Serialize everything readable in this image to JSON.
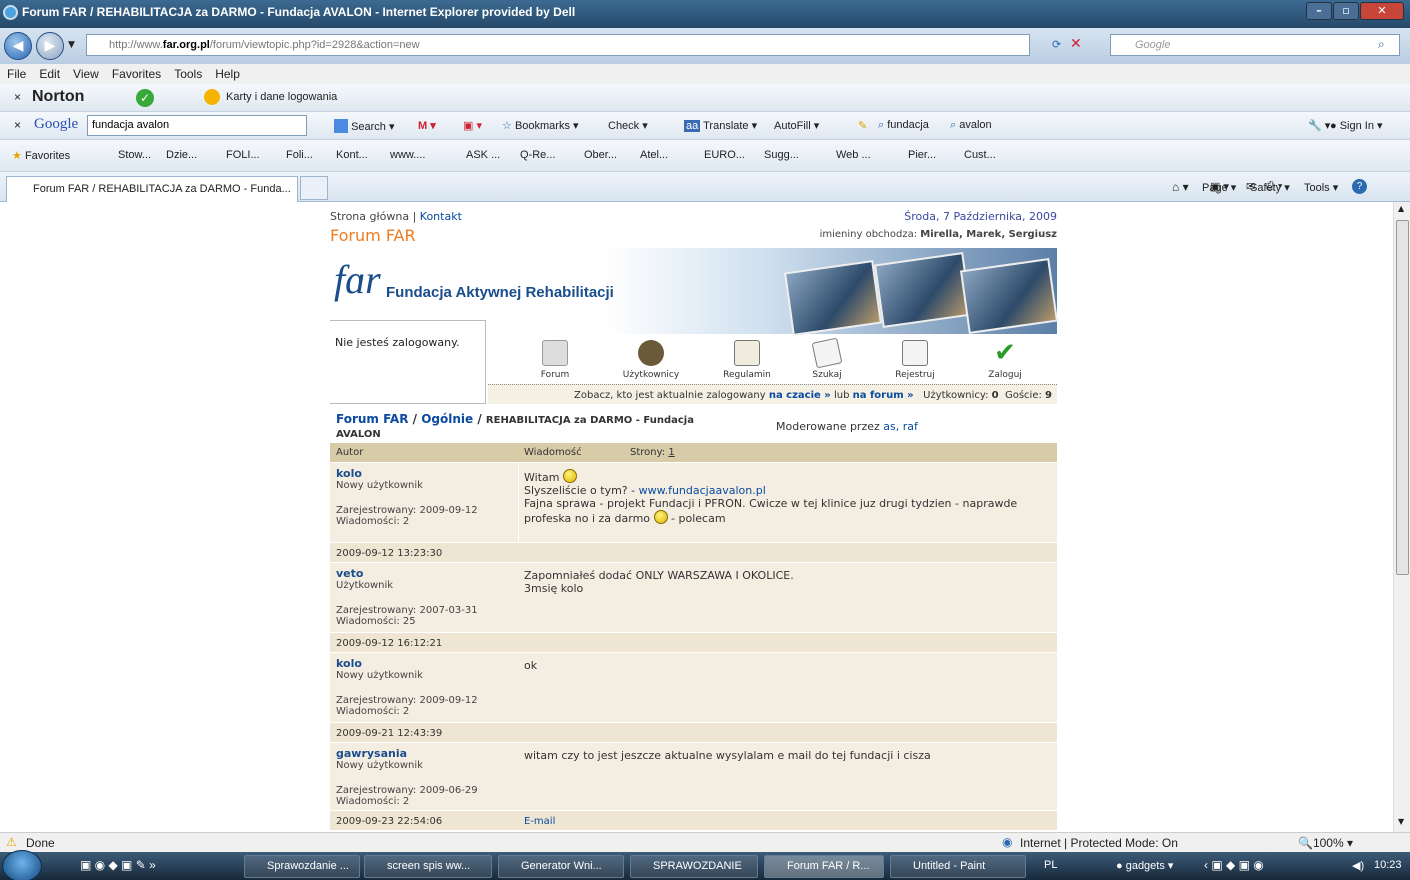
{
  "window": {
    "title": "Forum FAR / REHABILITACJA za DARMO - Fundacja AVALON - Internet Explorer provided by Dell"
  },
  "address": {
    "url_prefix": "http://www.",
    "url_domain": "far.org.pl",
    "url_suffix": "/forum/viewtopic.php?id=2928&action=new",
    "search_placeholder": "Google"
  },
  "menubar": [
    "File",
    "Edit",
    "View",
    "Favorites",
    "Tools",
    "Help"
  ],
  "norton": {
    "label": "Norton",
    "karty": "Karty i dane logowania"
  },
  "google_toolbar": {
    "logo": "Google",
    "query": "fundacja avalon",
    "search": "Search",
    "bookmarks": "Bookmarks",
    "check": "Check",
    "translate": "Translate",
    "autofill": "AutoFill",
    "word1": "fundacja",
    "word2": "avalon",
    "signin": "Sign In"
  },
  "favorites": {
    "label": "Favorites",
    "items": [
      "Stow...",
      "Dzie...",
      "FOLI...",
      "Foli...",
      "Kont...",
      "www....",
      "ASK ...",
      "Q-Re...",
      "Ober...",
      "Atel...",
      "EURO...",
      "Sugg...",
      "Web ...",
      "Pier...",
      "Cust..."
    ]
  },
  "tab": {
    "title": "Forum FAR / REHABILITACJA za DARMO - Funda..."
  },
  "commandbar": {
    "page": "Page",
    "safety": "Safety",
    "tools": "Tools"
  },
  "forum": {
    "home": "Strona główna",
    "sep": "|",
    "contact": "Kontakt",
    "date": "Środa, 7 Października, 2009",
    "title": "Forum FAR",
    "namedays_label": "imieniny obchodza:",
    "namedays": "Mirella, Marek, Sergiusz",
    "logo_text": "Fundacja Aktywnej Rehabilitacji",
    "not_logged": "Nie jesteś zalogowany.",
    "nav": [
      "Forum",
      "Użytkownicy",
      "Regulamin",
      "Szukaj",
      "Rejestruj",
      "Zaloguj"
    ],
    "who_pre": "Zobacz, kto jest aktualnie zalogowany",
    "who_link1": "na czacie »",
    "who_mid": "lub",
    "who_link2": "na forum »",
    "users_label": "Użytkownicy:",
    "users_count": "0",
    "guests_label": "Goście:",
    "guests_count": "9",
    "crumb1": "Forum FAR",
    "crumb2": "Ogólnie",
    "crumb3": "REHABILITACJA za DARMO - Fundacja",
    "crumb4": "AVALON",
    "moderated_label": "Moderowane przez",
    "moderators": "as, raf",
    "col_author": "Autor",
    "col_message": "Wiadomość",
    "pages_label": "Strony:",
    "page_num": "1",
    "posts": [
      {
        "name": "kolo",
        "rank": "Nowy użytkownik",
        "reg": "Zarejestrowany: 2009-09-12",
        "count": "Wiadomości: 2",
        "date": "2009-09-12 13:23:30",
        "line1": "Witam",
        "line2": "Slyszeliście o tym? -",
        "link": "www.fundacjaavalon.pl",
        "line3": "Fajna sprawa - projekt Fundacji i PFRON. Cwicze w tej klinice juz drugi tydzien - naprawde",
        "line4a": "profeska no i za darmo",
        "line4b": "- polecam"
      },
      {
        "name": "veto",
        "rank": "Użytkownik",
        "reg": "Zarejestrowany: 2007-03-31",
        "count": "Wiadomości: 25",
        "date": "2009-09-12 16:12:21",
        "line1": "Zapomniałeś dodać ONLY WARSZAWA I OKOLICE.",
        "line2": "3msię kolo"
      },
      {
        "name": "kolo",
        "rank": "Nowy użytkownik",
        "reg": "Zarejestrowany: 2009-09-12",
        "count": "Wiadomości: 2",
        "date": "2009-09-21 12:43:39",
        "line1": "ok"
      },
      {
        "name": "gawrysania",
        "rank": "Nowy użytkownik",
        "reg": "Zarejestrowany: 2009-06-29",
        "count": "Wiadomości: 2",
        "date": "2009-09-23 22:54:06",
        "line1": "witam czy to jest jeszcze aktualne wysylalam e mail do tej fundacji i cisza",
        "email": "E-mail"
      }
    ]
  },
  "status": {
    "text": "Done",
    "zone": "Internet | Protected Mode: On",
    "zoom": "100%"
  },
  "taskbar": {
    "items": [
      "Sprawozdanie ...",
      "screen spis ww...",
      "Generator Wni...",
      "SPRAWOZDANIE",
      "Forum FAR / R...",
      "Untitled - Paint"
    ],
    "lang": "PL",
    "gadgets": "gadgets",
    "clock": "10:23"
  }
}
